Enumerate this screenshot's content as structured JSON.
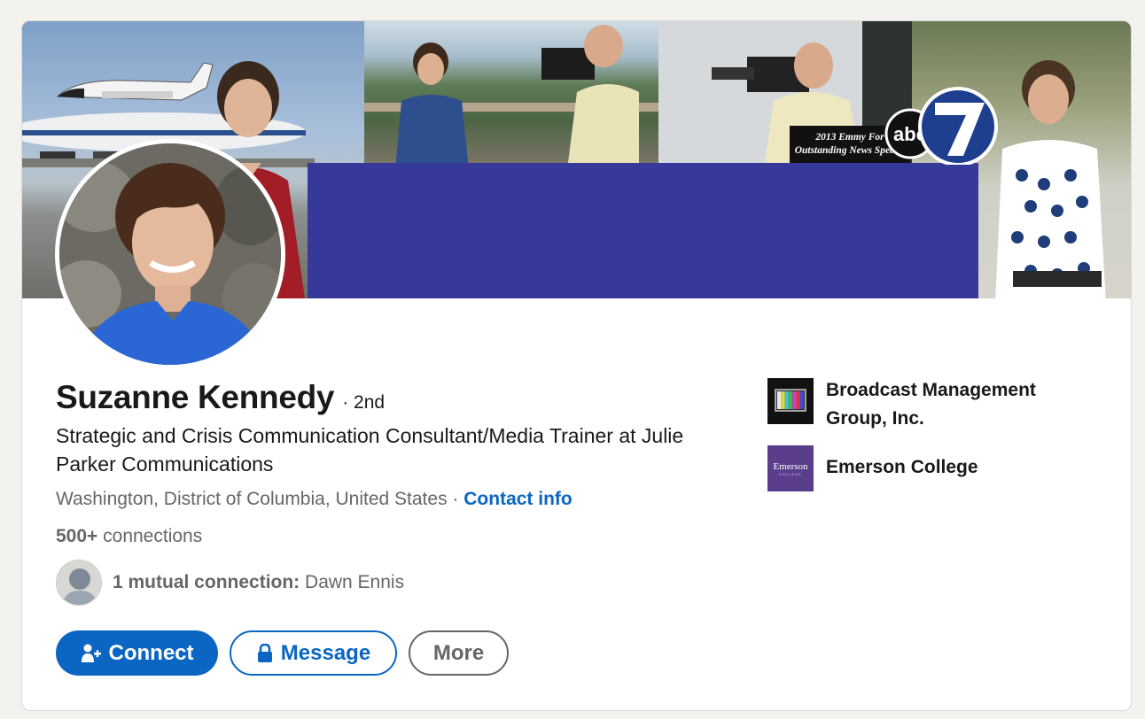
{
  "profile": {
    "name": "Suzanne Kennedy",
    "degree": "· 2nd",
    "headline": "Strategic and Crisis Communication Consultant/Media Trainer at Julie Parker Communications",
    "location": "Washington, District of Columbia, United States",
    "separator": " · ",
    "contact_info_label": "Contact info",
    "connections_count": "500+",
    "connections_label": " connections",
    "mutual_label": "1 mutual connection:",
    "mutual_name": " Dawn Ennis"
  },
  "banner": {
    "emmy_line1": "2013 Emmy For",
    "emmy_line2": "Outstanding News Special",
    "station_logo": "abc7"
  },
  "actions": {
    "connect_label": "Connect",
    "message_label": "Message",
    "more_label": "More"
  },
  "organizations": [
    {
      "name": "Broadcast Management Group, Inc.",
      "logo": "tv-color-bars-logo"
    },
    {
      "name": "Emerson College",
      "logo_text": "Emerson",
      "logo_subtext": "COLLEGE"
    }
  ],
  "colors": {
    "brand_blue": "#0a66c2",
    "banner_purple": "#37399a",
    "emerson_purple": "#5a3e8c",
    "text_secondary": "#666666"
  }
}
